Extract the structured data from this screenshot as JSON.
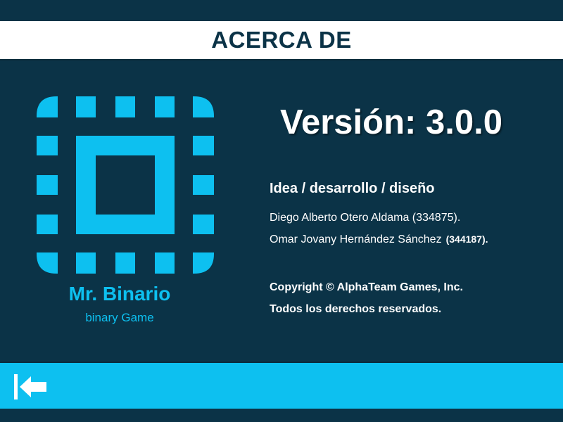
{
  "header": {
    "title": "ACERCA DE"
  },
  "app": {
    "name": "Mr. Binario",
    "subtitle": "binary Game",
    "logo_icon": "chip-icon"
  },
  "version_text": "Versión: 3.0.0",
  "credits": {
    "heading": "Idea / desarrollo / diseño",
    "line1": "Diego Alberto Otero Aldama (334875).",
    "line2_name": "Omar Jovany Hernández Sánchez",
    "line2_id": "(344187)."
  },
  "copyright": {
    "line1": "Copyright © AlphaTeam Games, Inc.",
    "line2": "Todos los derechos reservados."
  },
  "footer": {
    "back_icon": "back-to-start-arrow-icon"
  },
  "colors": {
    "background": "#0b3347",
    "accent": "#0dc0f0",
    "header_bg": "#ffffff",
    "text": "#ffffff"
  }
}
